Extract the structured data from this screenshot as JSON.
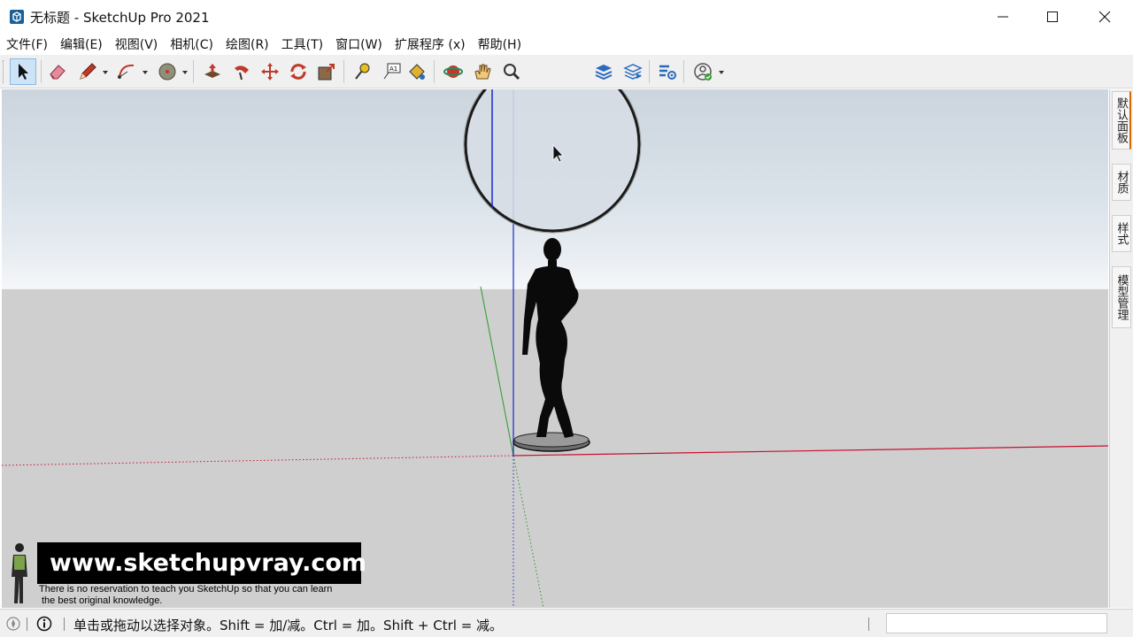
{
  "window": {
    "title": "无标题 - SketchUp Pro 2021",
    "minimize_icon": "minimize-icon",
    "maximize_icon": "maximize-icon",
    "close_icon": "close-icon"
  },
  "menu": [
    {
      "label": "文件(F)"
    },
    {
      "label": "编辑(E)"
    },
    {
      "label": "视图(V)"
    },
    {
      "label": "相机(C)"
    },
    {
      "label": "绘图(R)"
    },
    {
      "label": "工具(T)"
    },
    {
      "label": "窗口(W)"
    },
    {
      "label": "扩展程序 (x)"
    },
    {
      "label": "帮助(H)"
    }
  ],
  "toolbar": {
    "tools": [
      {
        "name": "select-tool",
        "icon": "arrow-cursor-icon",
        "active": true
      },
      {
        "name": "eraser-tool",
        "icon": "eraser-icon"
      },
      {
        "name": "line-tool",
        "icon": "pencil-icon"
      },
      {
        "name": "arc-tool",
        "icon": "arc-icon"
      },
      {
        "name": "shape-tool",
        "icon": "circle-shape-icon"
      },
      {
        "name": "push-pull-tool",
        "icon": "push-pull-icon"
      },
      {
        "name": "follow-me-tool",
        "icon": "follow-me-icon"
      },
      {
        "name": "move-tool",
        "icon": "move-arrows-icon"
      },
      {
        "name": "rotate-tool",
        "icon": "rotate-icon"
      },
      {
        "name": "scale-tool",
        "icon": "scale-icon"
      },
      {
        "name": "tape-measure-tool",
        "icon": "tape-measure-icon"
      },
      {
        "name": "text-tool",
        "icon": "text-label-icon"
      },
      {
        "name": "paint-bucket-tool",
        "icon": "paint-bucket-icon"
      },
      {
        "name": "orbit-tool",
        "icon": "orbit-icon"
      },
      {
        "name": "pan-tool",
        "icon": "hand-icon"
      },
      {
        "name": "zoom-tool",
        "icon": "magnifier-icon"
      },
      {
        "name": "layer-tool",
        "icon": "layers-icon"
      },
      {
        "name": "warehouse-tool",
        "icon": "warehouse-icon"
      },
      {
        "name": "extension-tool",
        "icon": "extension-gear-icon"
      },
      {
        "name": "account-tool",
        "icon": "account-icon"
      }
    ]
  },
  "side_panel": {
    "tabs": [
      "默认面板",
      "材质",
      "样式",
      "模型管理"
    ]
  },
  "watermark": {
    "site": "www.sketchupvray.com",
    "line1": "There is no reservation to teach you SketchUp so that you can learn",
    "line2": "the best original knowledge."
  },
  "status": {
    "left_icon": "geolocation-icon",
    "info_icon": "info-icon",
    "message": "单击或拖动以选择对象。Shift = 加/减。Ctrl = 加。Shift + Ctrl = 减。",
    "measurements_value": ""
  },
  "colors": {
    "red_axis": "#c8102e",
    "green_axis": "#2a9a2a",
    "blue_axis": "#1a2cc8",
    "accent_tab": "#d26a00"
  }
}
